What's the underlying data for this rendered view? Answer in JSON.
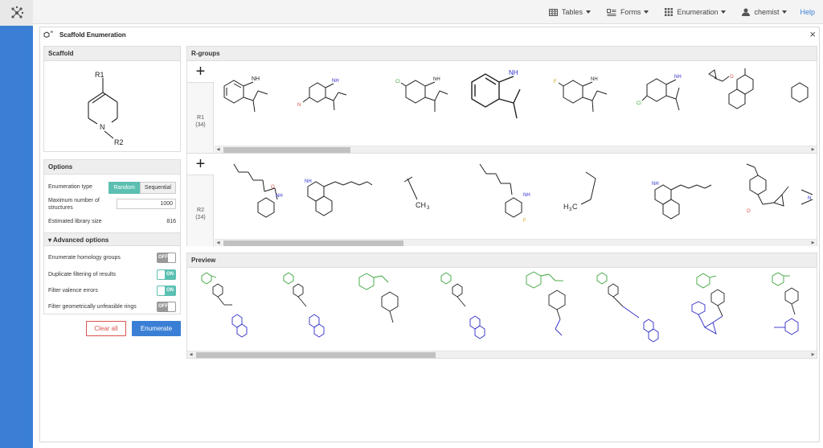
{
  "topbar": {
    "tables_label": "Tables",
    "forms_label": "Forms",
    "enumeration_label": "Enumeration",
    "user_label": "chemist",
    "help_label": "Help"
  },
  "window": {
    "title": "Scaffold Enumeration",
    "close_glyph": "×"
  },
  "scaffold": {
    "heading": "Scaffold",
    "r1": "R1",
    "r2": "R2",
    "n": "N"
  },
  "options": {
    "heading": "Options",
    "enum_type_label": "Enumeration type",
    "random_label": "Random",
    "sequential_label": "Sequential",
    "max_label_line1": "Maximum number of",
    "max_label_line2": "structures",
    "max_value": "1000",
    "est_label": "Estimated library size",
    "est_value": "816"
  },
  "advanced": {
    "heading": "▾ Advanced options",
    "items": [
      {
        "label": "Enumerate homology groups",
        "state": "OFF"
      },
      {
        "label": "Duplicate filtering of results",
        "state": "ON"
      },
      {
        "label": "Filter valence errors",
        "state": "ON"
      },
      {
        "label": "Filter geometrically unfeasible rings",
        "state": "OFF"
      }
    ]
  },
  "buttons": {
    "clear_label": "Clear all",
    "enumerate_label": "Enumerate"
  },
  "rgroups": {
    "heading": "R-groups",
    "plus": "+",
    "rows": [
      {
        "name": "R1",
        "count": "(34)"
      },
      {
        "name": "R2",
        "count": "(24)"
      }
    ],
    "atom_labels": {
      "nh": "NH",
      "ch3": "CH",
      "sub3": "3",
      "cl": "Cl",
      "f": "F",
      "o": "O",
      "n": "N",
      "h3c": "H",
      "h3c_sub": "3",
      "h3c_c": "C"
    }
  },
  "preview": {
    "heading": "Preview"
  },
  "colors": {
    "accent": "#3a7fd5",
    "teal": "#5bc0b2",
    "green": "#3aa33a",
    "blue": "#2d2dc8",
    "red": "#d9534f"
  }
}
